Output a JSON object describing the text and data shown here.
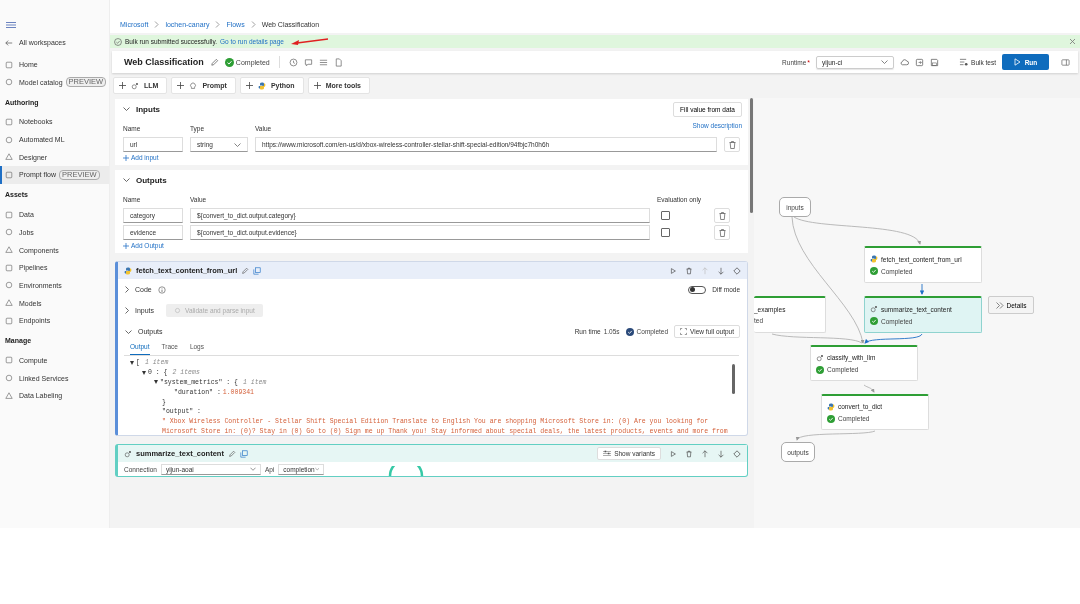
{
  "sidebar": {
    "back_link": "All workspaces",
    "sections": [
      {
        "items": [
          {
            "label": "Home",
            "selected": false
          },
          {
            "label": "Model catalog",
            "badge": "PREVIEW",
            "selected": false
          }
        ]
      },
      {
        "heading": "Authoring",
        "items": [
          {
            "label": "Notebooks",
            "selected": false
          },
          {
            "label": "Automated ML",
            "selected": false
          },
          {
            "label": "Designer",
            "selected": false
          },
          {
            "label": "Prompt flow",
            "badge": "PREVIEW",
            "selected": true
          }
        ]
      },
      {
        "heading": "Assets",
        "items": [
          {
            "label": "Data",
            "selected": false
          },
          {
            "label": "Jobs",
            "selected": false
          },
          {
            "label": "Components",
            "selected": false
          },
          {
            "label": "Pipelines",
            "selected": false
          },
          {
            "label": "Environments",
            "selected": false
          },
          {
            "label": "Models",
            "selected": false
          },
          {
            "label": "Endpoints",
            "selected": false
          }
        ]
      },
      {
        "heading": "Manage",
        "items": [
          {
            "label": "Compute",
            "selected": false
          },
          {
            "label": "Linked Services",
            "selected": false
          },
          {
            "label": "Data Labeling",
            "selected": false
          }
        ]
      }
    ]
  },
  "breadcrumb": [
    "Microsoft",
    "lochen-canary",
    "Flows",
    "Web Classification"
  ],
  "banner": {
    "message": "Bulk run submitted successfully.",
    "link": "Go to run details page"
  },
  "header": {
    "title": "Web Classification",
    "status": "Completed",
    "runtime_label": "Runtime",
    "runtime_required_mark": "*",
    "runtime": "yijun-ci",
    "bulk_test": "Bulk test",
    "run": "Run"
  },
  "tools": [
    {
      "label": "LLM",
      "kind": "llm"
    },
    {
      "label": "Prompt",
      "kind": "prompt"
    },
    {
      "label": "Python",
      "kind": "python"
    },
    {
      "label": "More tools",
      "kind": "more"
    }
  ],
  "inputs": {
    "title": "Inputs",
    "expanded": true,
    "fill_button": "Fill value from data",
    "show_description": "Show description",
    "columns": [
      "Name",
      "Type",
      "Value"
    ],
    "rows": [
      {
        "name": "url",
        "type": "string",
        "value": "https://www.microsoft.com/en-us/d/xbox-wireless-controller-stellar-shift-special-edition/94fbjc7h0h6h"
      }
    ],
    "add": "Add input"
  },
  "outputs": {
    "title": "Outputs",
    "expanded": true,
    "columns": [
      "Name",
      "Value",
      "Evaluation only"
    ],
    "rows": [
      {
        "name": "category",
        "value": "${convert_to_dict.output.category}",
        "evaluation_only": false
      },
      {
        "name": "evidence",
        "value": "${convert_to_dict.output.evidence}",
        "evaluation_only": false
      }
    ],
    "add": "Add Output"
  },
  "fetch_panel": {
    "name": "fetch_text_content_from_url",
    "code": "Code",
    "code_expanded": false,
    "diff_mode": "Diff mode",
    "diff_on": false,
    "inputs": "Inputs",
    "inputs_expanded": false,
    "validate": "Validate and parse input",
    "outputs": "Outputs",
    "outputs_expanded": true,
    "run_time_label": "Run time",
    "run_time": "1.05s",
    "status": "Completed",
    "view_full": "View full output",
    "tabs": [
      {
        "label": "Output",
        "selected": true
      },
      {
        "label": "Trace",
        "selected": false
      },
      {
        "label": "Logs",
        "selected": false
      }
    ],
    "tree": [
      {
        "expanded": true,
        "label": "[",
        "hint": "1 item",
        "children": [
          {
            "expanded": true,
            "label": "0 : {",
            "hint": "2 items",
            "children": [
              {
                "expanded": true,
                "label": "\"system_metrics\" : {",
                "hint": "1 item",
                "children": [
                  {
                    "label": "\"duration\" : ",
                    "number": "1.009341"
                  }
                ]
              },
              {
                "label": "}"
              },
              {
                "label": "\"output\" :"
              },
              {
                "string": "\" Xbox Wireless Controller - Stellar Shift Special Edition Translate to English You are shopping Microsoft Store in: (0) Are you looking for"
              },
              {
                "string": "Microsoft Store in: (0)? Stay in (0) Go to (0) Sign me up Thank you! Stay informed about special deals, the latest products, events and more from"
              }
            ]
          }
        ]
      }
    ]
  },
  "summarize_panel": {
    "name": "summarize_text_content",
    "show_variants": "Show variants",
    "connection_label": "Connection",
    "connection": "yijun-aoai",
    "api_label": "Api",
    "api": "completion"
  },
  "graph": {
    "nodes": [
      {
        "kind": "io",
        "name": "inputs"
      },
      {
        "kind": "python",
        "name": "fetch_text_content_from_url",
        "status": "Completed",
        "selected": false
      },
      {
        "kind": "partial",
        "name": "_examples",
        "status": "ted",
        "selected": false
      },
      {
        "kind": "llm",
        "name": "summarize_text_content",
        "status": "Completed",
        "selected": true
      },
      {
        "kind": "llm",
        "name": "classify_with_llm",
        "status": "Completed",
        "selected": false
      },
      {
        "kind": "python",
        "name": "convert_to_dict",
        "status": "Completed",
        "selected": false
      },
      {
        "kind": "io",
        "name": "outputs"
      }
    ],
    "details": "Details"
  }
}
